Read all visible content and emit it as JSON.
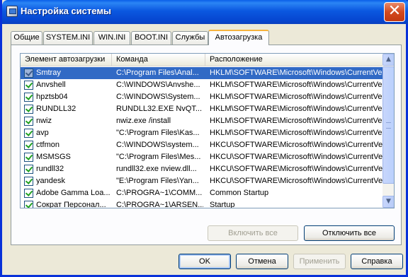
{
  "window": {
    "title": "Настройка системы",
    "close_glyph": "✕"
  },
  "tabs": [
    {
      "label": "Общие",
      "active": false
    },
    {
      "label": "SYSTEM.INI",
      "active": false
    },
    {
      "label": "WIN.INI",
      "active": false
    },
    {
      "label": "BOOT.INI",
      "active": false
    },
    {
      "label": "Службы",
      "active": false
    },
    {
      "label": "Автозагрузка",
      "active": true
    }
  ],
  "startup_list": {
    "columns": [
      "Элемент автозагрузки",
      "Команда",
      "Расположение"
    ],
    "rows": [
      {
        "item": "Smtray",
        "command": "C:\\Program Files\\Anal...",
        "location": "HKLM\\SOFTWARE\\Microsoft\\Windows\\CurrentVer...",
        "checked": true,
        "selected": true
      },
      {
        "item": "Anvshell",
        "command": "C:\\WINDOWS\\Anvshe...",
        "location": "HKLM\\SOFTWARE\\Microsoft\\Windows\\CurrentVer...",
        "checked": true,
        "selected": false
      },
      {
        "item": "hpztsb04",
        "command": "C:\\WINDOWS\\System...",
        "location": "HKLM\\SOFTWARE\\Microsoft\\Windows\\CurrentVer...",
        "checked": true,
        "selected": false
      },
      {
        "item": "RUNDLL32",
        "command": "RUNDLL32.EXE NvQT...",
        "location": "HKLM\\SOFTWARE\\Microsoft\\Windows\\CurrentVer...",
        "checked": true,
        "selected": false
      },
      {
        "item": "nwiz",
        "command": "nwiz.exe /install",
        "location": "HKLM\\SOFTWARE\\Microsoft\\Windows\\CurrentVer...",
        "checked": true,
        "selected": false
      },
      {
        "item": "avp",
        "command": "\"C:\\Program Files\\Kas...",
        "location": "HKLM\\SOFTWARE\\Microsoft\\Windows\\CurrentVer...",
        "checked": true,
        "selected": false
      },
      {
        "item": "ctfmon",
        "command": "C:\\WINDOWS\\system...",
        "location": "HKCU\\SOFTWARE\\Microsoft\\Windows\\CurrentVer...",
        "checked": true,
        "selected": false
      },
      {
        "item": "MSMSGS",
        "command": "\"C:\\Program Files\\Mes...",
        "location": "HKCU\\SOFTWARE\\Microsoft\\Windows\\CurrentVer...",
        "checked": true,
        "selected": false
      },
      {
        "item": "rundll32",
        "command": "rundll32.exe nview.dll...",
        "location": "HKCU\\SOFTWARE\\Microsoft\\Windows\\CurrentVer...",
        "checked": true,
        "selected": false
      },
      {
        "item": "yandesk",
        "command": "\"E:\\Program Files\\Yan...",
        "location": "HKCU\\SOFTWARE\\Microsoft\\Windows\\CurrentVer...",
        "checked": true,
        "selected": false
      },
      {
        "item": "Adobe Gamma Loa...",
        "command": "C:\\PROGRA~1\\COMM...",
        "location": "Common Startup",
        "checked": true,
        "selected": false
      },
      {
        "item": "Сократ Персонал...",
        "command": "C:\\PROGRA~1\\ARSEN...",
        "location": "Startup",
        "checked": true,
        "selected": false
      }
    ],
    "scroll_up_glyph": "▲",
    "scroll_down_glyph": "▼"
  },
  "panel_buttons": {
    "enable_all": "Включить все",
    "disable_all": "Отключить все"
  },
  "dialog_buttons": {
    "ok": "OK",
    "cancel": "Отмена",
    "apply": "Применить",
    "help": "Справка"
  },
  "colors": {
    "titlebar": "#0b58e0",
    "selection": "#316ac5",
    "active_tab_accent": "#f7b33d",
    "checkmark": "#21a121"
  }
}
